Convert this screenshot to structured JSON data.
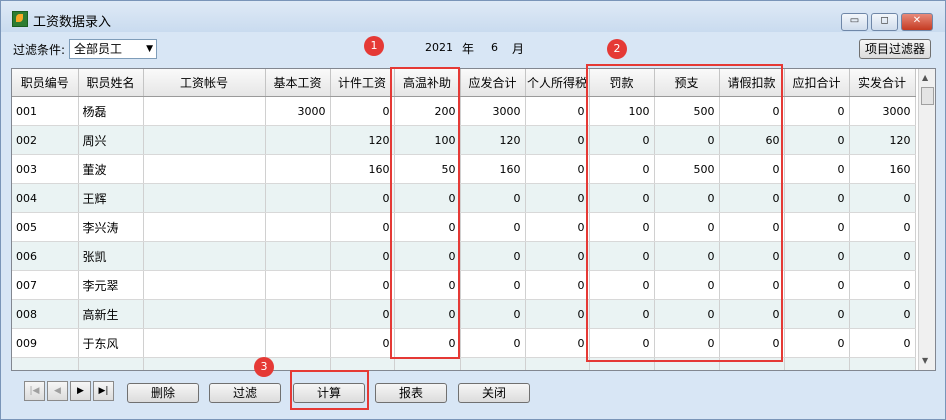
{
  "window": {
    "title": "工资数据录入",
    "controls": {
      "minimize": "▭",
      "maximize": "◻",
      "close": "✕"
    }
  },
  "filter": {
    "label": "过滤条件:",
    "selected": "全部员工",
    "year": "2021",
    "year_unit": "年",
    "month": "6",
    "month_unit": "月",
    "filter_button": "项目过滤器"
  },
  "table": {
    "columns": [
      "职员编号",
      "职员姓名",
      "工资帐号",
      "基本工资",
      "计件工资",
      "高温补助",
      "应发合计",
      "个人所得税",
      "罚款",
      "预支",
      "请假扣款",
      "应扣合计",
      "实发合计"
    ],
    "rows": [
      [
        "001",
        "杨磊",
        "",
        "3000",
        "0",
        "200",
        "3000",
        "0",
        "100",
        "500",
        "0",
        "0",
        "3000"
      ],
      [
        "002",
        "周兴",
        "",
        "",
        "120",
        "100",
        "120",
        "0",
        "0",
        "0",
        "60",
        "0",
        "120"
      ],
      [
        "003",
        "董波",
        "",
        "",
        "160",
        "50",
        "160",
        "0",
        "0",
        "500",
        "0",
        "0",
        "160"
      ],
      [
        "004",
        "王辉",
        "",
        "",
        "0",
        "0",
        "0",
        "0",
        "0",
        "0",
        "0",
        "0",
        "0"
      ],
      [
        "005",
        "李兴涛",
        "",
        "",
        "0",
        "0",
        "0",
        "0",
        "0",
        "0",
        "0",
        "0",
        "0"
      ],
      [
        "006",
        "张凯",
        "",
        "",
        "0",
        "0",
        "0",
        "0",
        "0",
        "0",
        "0",
        "0",
        "0"
      ],
      [
        "007",
        "李元翠",
        "",
        "",
        "0",
        "0",
        "0",
        "0",
        "0",
        "0",
        "0",
        "0",
        "0"
      ],
      [
        "008",
        "高新生",
        "",
        "",
        "0",
        "0",
        "0",
        "0",
        "0",
        "0",
        "0",
        "0",
        "0"
      ],
      [
        "009",
        "于东风",
        "",
        "",
        "0",
        "0",
        "0",
        "0",
        "0",
        "0",
        "0",
        "0",
        "0"
      ]
    ]
  },
  "annotations": [
    "1",
    "2",
    "3"
  ],
  "nav": {
    "first": "|◀",
    "prev": "◀",
    "next": "▶",
    "last": "▶|"
  },
  "buttons": {
    "delete": "删除",
    "filter": "过滤",
    "calculate": "计算",
    "report": "报表",
    "close": "关闭"
  },
  "colors": {
    "highlight": "#e53935",
    "alt_row": "#eaf3f3"
  }
}
